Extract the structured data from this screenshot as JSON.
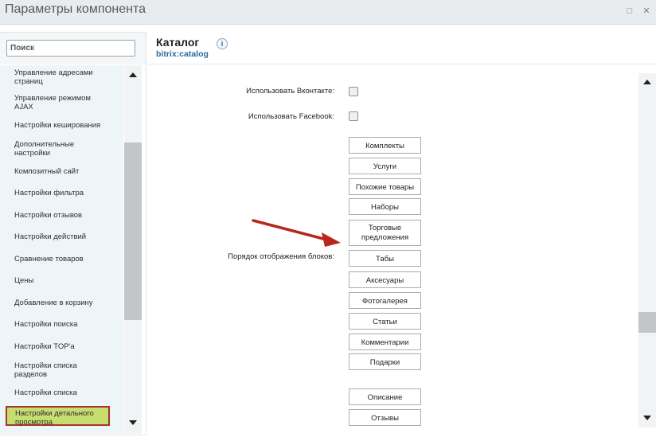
{
  "window": {
    "title": "Параметры компонента"
  },
  "search": {
    "placeholder": "Поиск"
  },
  "sidebar": {
    "items": [
      "Управление адресами страниц",
      "Управление режимом AJAX",
      "Настройки кеширования",
      "Дополнительные настройки",
      "Композитный сайт",
      "Настройки фильтра",
      "Настройки отзывов",
      "Настройки действий",
      "Сравнение товаров",
      "Цены",
      "Добавление в корзину",
      "Настройки поиска",
      "Настройки TOP'а",
      "Настройки списка разделов",
      "Настройки списка",
      "Настройки детального просмотра"
    ],
    "active_index": 15
  },
  "component": {
    "name": "Каталог",
    "code": "bitrix:catalog"
  },
  "settings": {
    "vk_label": "Использовать Вконтакте:",
    "fb_label": "Использовать Facebook:",
    "blocks_label": "Порядок отображения блоков:",
    "blocks": [
      "Комплекты",
      "Услуги",
      "Похожие товары",
      "Наборы",
      "Торговые предложения",
      "Табы",
      "Аксесуары",
      "Фотогалерея",
      "Статьи",
      "Комментарии",
      "Подарки"
    ],
    "blocks2": [
      "Описание",
      "Отзывы"
    ]
  },
  "colors": {
    "active_item_bg": "#c8dd70",
    "active_item_border": "#a8352d",
    "arrow": "#b8261c",
    "link": "#2a6a9b"
  }
}
